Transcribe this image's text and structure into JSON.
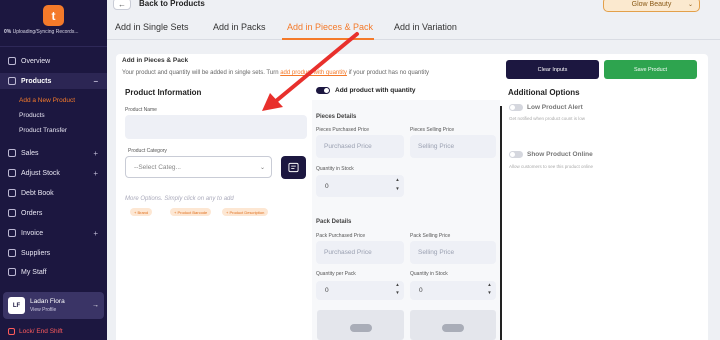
{
  "sidebar": {
    "logo_letter": "t",
    "sync": {
      "percent": "0%",
      "text": "Uploading/Syncing Records..."
    },
    "nav": [
      {
        "label": "Overview",
        "icon": "grid-icon"
      },
      {
        "label": "Products",
        "icon": "box-icon"
      },
      {
        "label": "Sales",
        "icon": "cart-icon"
      },
      {
        "label": "Adjust Stock",
        "icon": "adjust-icon"
      },
      {
        "label": "Debt Book",
        "icon": "book-icon"
      },
      {
        "label": "Orders",
        "icon": "orders-icon"
      },
      {
        "label": "Invoice",
        "icon": "invoice-icon"
      },
      {
        "label": "Suppliers",
        "icon": "truck-icon"
      },
      {
        "label": "My Staff",
        "icon": "users-icon"
      }
    ],
    "products_submenu": [
      "Add a New Product",
      "Products",
      "Product Transfer"
    ],
    "collapse_glyph": "−",
    "expand_glyph": "+",
    "profile": {
      "initials": "LF",
      "name": "Ladan Flora",
      "link": "View Profile"
    },
    "lock_label": "Lock/ End Shift"
  },
  "header": {
    "back_arrow": "←",
    "title": "Back to Products",
    "store": "Glow Beauty",
    "store_chevron": "⌄"
  },
  "tabs": [
    "Add in Single Sets",
    "Add in Packs",
    "Add in Pieces & Pack",
    "Add in Variation"
  ],
  "active_tab": "Add in Pieces & Pack",
  "page": {
    "title": "Add in Pieces & Pack",
    "desc_before": "Your product and quantity will be added in single sets. Turn",
    "desc_link": "add product with quantity",
    "desc_after": "if your product has no quantity",
    "clear_btn": "Clear Inputs",
    "save_btn": "Save Product"
  },
  "product_info": {
    "heading": "Product Information",
    "name_label": "Product Name",
    "name_value": "",
    "category_label": "Product Category",
    "category_placeholder": "--Select Categ...",
    "more_options": "More Options. Simply click on any to add",
    "chips": [
      "+ Brand",
      "+ Product Barcode",
      "+ Product Description"
    ]
  },
  "quantity": {
    "toggle_label": "Add product with quantity",
    "toggle_on": true,
    "pieces_heading": "Pieces Details",
    "pieces_purchased_label": "Pieces Purchased Price",
    "pieces_purchased_placeholder": "Purchased Price",
    "pieces_selling_label": "Pieces Selling Price",
    "pieces_selling_placeholder": "Selling Price",
    "qty_in_stock_label": "Quantity in Stock",
    "qty_in_stock_value": "0",
    "pack_heading": "Pack Details",
    "pack_purchased_label": "Pack Purchased Price",
    "pack_purchased_placeholder": "Purchased Price",
    "pack_selling_label": "Pack Selling Price",
    "pack_selling_placeholder": "Selling Price",
    "qty_per_pack_label": "Quantity per Pack",
    "qty_per_pack_value": "0",
    "pack_qty_in_stock_label": "Quantity in Stock",
    "pack_qty_in_stock_value": "0",
    "spin_up": "▲",
    "spin_down": "▼"
  },
  "additional": {
    "heading": "Additional Options",
    "low_alert_label": "Low Product Alert",
    "low_alert_hint": "Get notified when product count is low",
    "show_online_label": "Show Product Online",
    "show_online_hint": "Allow customers to see this product online"
  },
  "colors": {
    "sidebar_bg": "#1c1740",
    "accent_orange": "#f47a2a",
    "save_green": "#2ea44f",
    "annotation_arrow": "#e8302c"
  }
}
